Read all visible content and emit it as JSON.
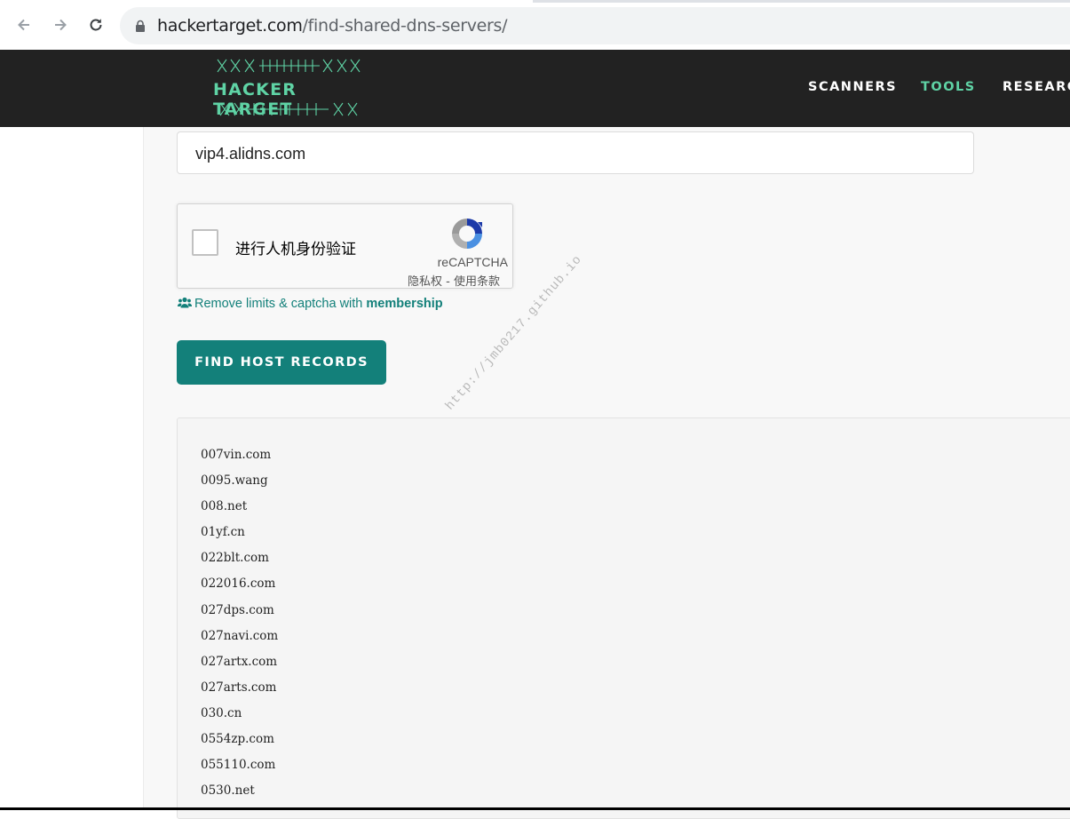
{
  "browser": {
    "url_host": "hackertarget.com",
    "url_path": "/find-shared-dns-servers/"
  },
  "header": {
    "logo_text": "HACKER TARGET",
    "nav": [
      {
        "label": "SCANNERS"
      },
      {
        "label": "TOOLS",
        "active": true
      },
      {
        "label": "RESEARC"
      }
    ],
    "accent_color": "#5fd3a5",
    "background": "#222222"
  },
  "form": {
    "input_value": "vip4.alidns.com",
    "captcha": {
      "label": "进行人机身份验证",
      "brand": "reCAPTCHA",
      "terms": "隐私权 - 使用条款"
    },
    "membership": {
      "prefix": "Remove limits & captcha with",
      "link": "membership"
    },
    "submit_label": "FIND HOST RECORDS",
    "button_color": "#13807a"
  },
  "results": [
    "007vin.com",
    "0095.wang",
    "008.net",
    "01yf.cn",
    "022blt.com",
    "022016.com",
    "027dps.com",
    "027navi.com",
    "027artx.com",
    "027arts.com",
    "030.cn",
    "0554zp.com",
    "055110.com",
    "0530.net"
  ],
  "watermark": "http://jmb0217.github.io"
}
